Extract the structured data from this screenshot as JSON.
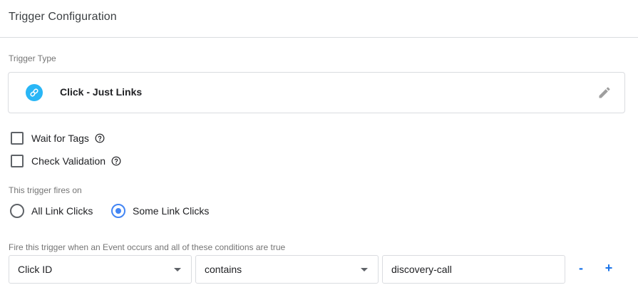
{
  "header": {
    "title": "Trigger Configuration"
  },
  "trigger_type": {
    "label": "Trigger Type",
    "name": "Click - Just Links",
    "icon": "link-icon",
    "icon_color": "#29b6f6",
    "edit_icon": "pencil-icon"
  },
  "options": [
    {
      "label": "Wait for Tags",
      "checked": false,
      "help_icon": "help-circle-icon"
    },
    {
      "label": "Check Validation",
      "checked": false,
      "help_icon": "help-circle-icon"
    }
  ],
  "fires_on": {
    "label": "This trigger fires on",
    "choices": [
      {
        "label": "All Link Clicks",
        "selected": false
      },
      {
        "label": "Some Link Clicks",
        "selected": true
      }
    ],
    "accent_color": "#4285f4"
  },
  "conditions": {
    "label": "Fire this trigger when an Event occurs and all of these conditions are true",
    "rows": [
      {
        "variable": "Click ID",
        "operator": "contains",
        "value": "discovery-call"
      }
    ],
    "remove_label": "-",
    "add_label": "+"
  }
}
